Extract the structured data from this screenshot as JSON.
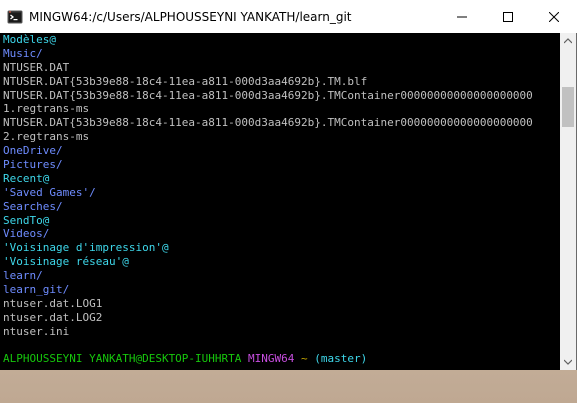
{
  "window": {
    "title": "MINGW64:/c/Users/ALPHOUSSEYNI YANKATH/learn_git",
    "icons": {
      "app": "git-bash-icon",
      "minimize": "minimize-icon",
      "maximize": "maximize-icon",
      "close": "close-icon"
    }
  },
  "terminal": {
    "lines": [
      {
        "text": "Modèles@",
        "type": "link"
      },
      {
        "text": "Music/",
        "type": "dir"
      },
      {
        "text": "NTUSER.DAT",
        "type": "file"
      },
      {
        "text": "NTUSER.DAT{53b39e88-18c4-11ea-a811-000d3aa4692b}.TM.blf",
        "type": "file"
      },
      {
        "text": "NTUSER.DAT{53b39e88-18c4-11ea-a811-000d3aa4692b}.TMContainer00000000000000000000",
        "type": "file"
      },
      {
        "text": "1.regtrans-ms",
        "type": "file"
      },
      {
        "text": "NTUSER.DAT{53b39e88-18c4-11ea-a811-000d3aa4692b}.TMContainer00000000000000000000",
        "type": "file"
      },
      {
        "text": "2.regtrans-ms",
        "type": "file"
      },
      {
        "text": "OneDrive/",
        "type": "dir"
      },
      {
        "text": "Pictures/",
        "type": "dir"
      },
      {
        "text": "Recent@",
        "type": "link"
      },
      {
        "text": "'Saved Games'/",
        "type": "dir"
      },
      {
        "text": "Searches/",
        "type": "dir"
      },
      {
        "text": "SendTo@",
        "type": "link"
      },
      {
        "text": "Videos/",
        "type": "dir"
      },
      {
        "text": "'Voisinage d'impression'@",
        "type": "link"
      },
      {
        "text": "'Voisinage réseau'@",
        "type": "link"
      },
      {
        "text": "learn/",
        "type": "dir"
      },
      {
        "text": "learn_git/",
        "type": "dir"
      },
      {
        "text": "ntuser.dat.LOG1",
        "type": "file"
      },
      {
        "text": "ntuser.dat.LOG2",
        "type": "file"
      },
      {
        "text": "ntuser.ini",
        "type": "file"
      },
      {
        "text": "",
        "type": "file"
      }
    ],
    "prompt": {
      "user_host": "ALPHOUSSEYNI YANKATH@DESKTOP-IUHHRTA",
      "system": "MINGW64",
      "path": "~",
      "branch": "(master)"
    }
  },
  "colors": {
    "dir": "#6e8cff",
    "link": "#3ed7ea",
    "file": "#c0c0c0",
    "prompt_user": "#16c60c",
    "prompt_system": "#c84ee0",
    "prompt_path": "#c6a700"
  }
}
